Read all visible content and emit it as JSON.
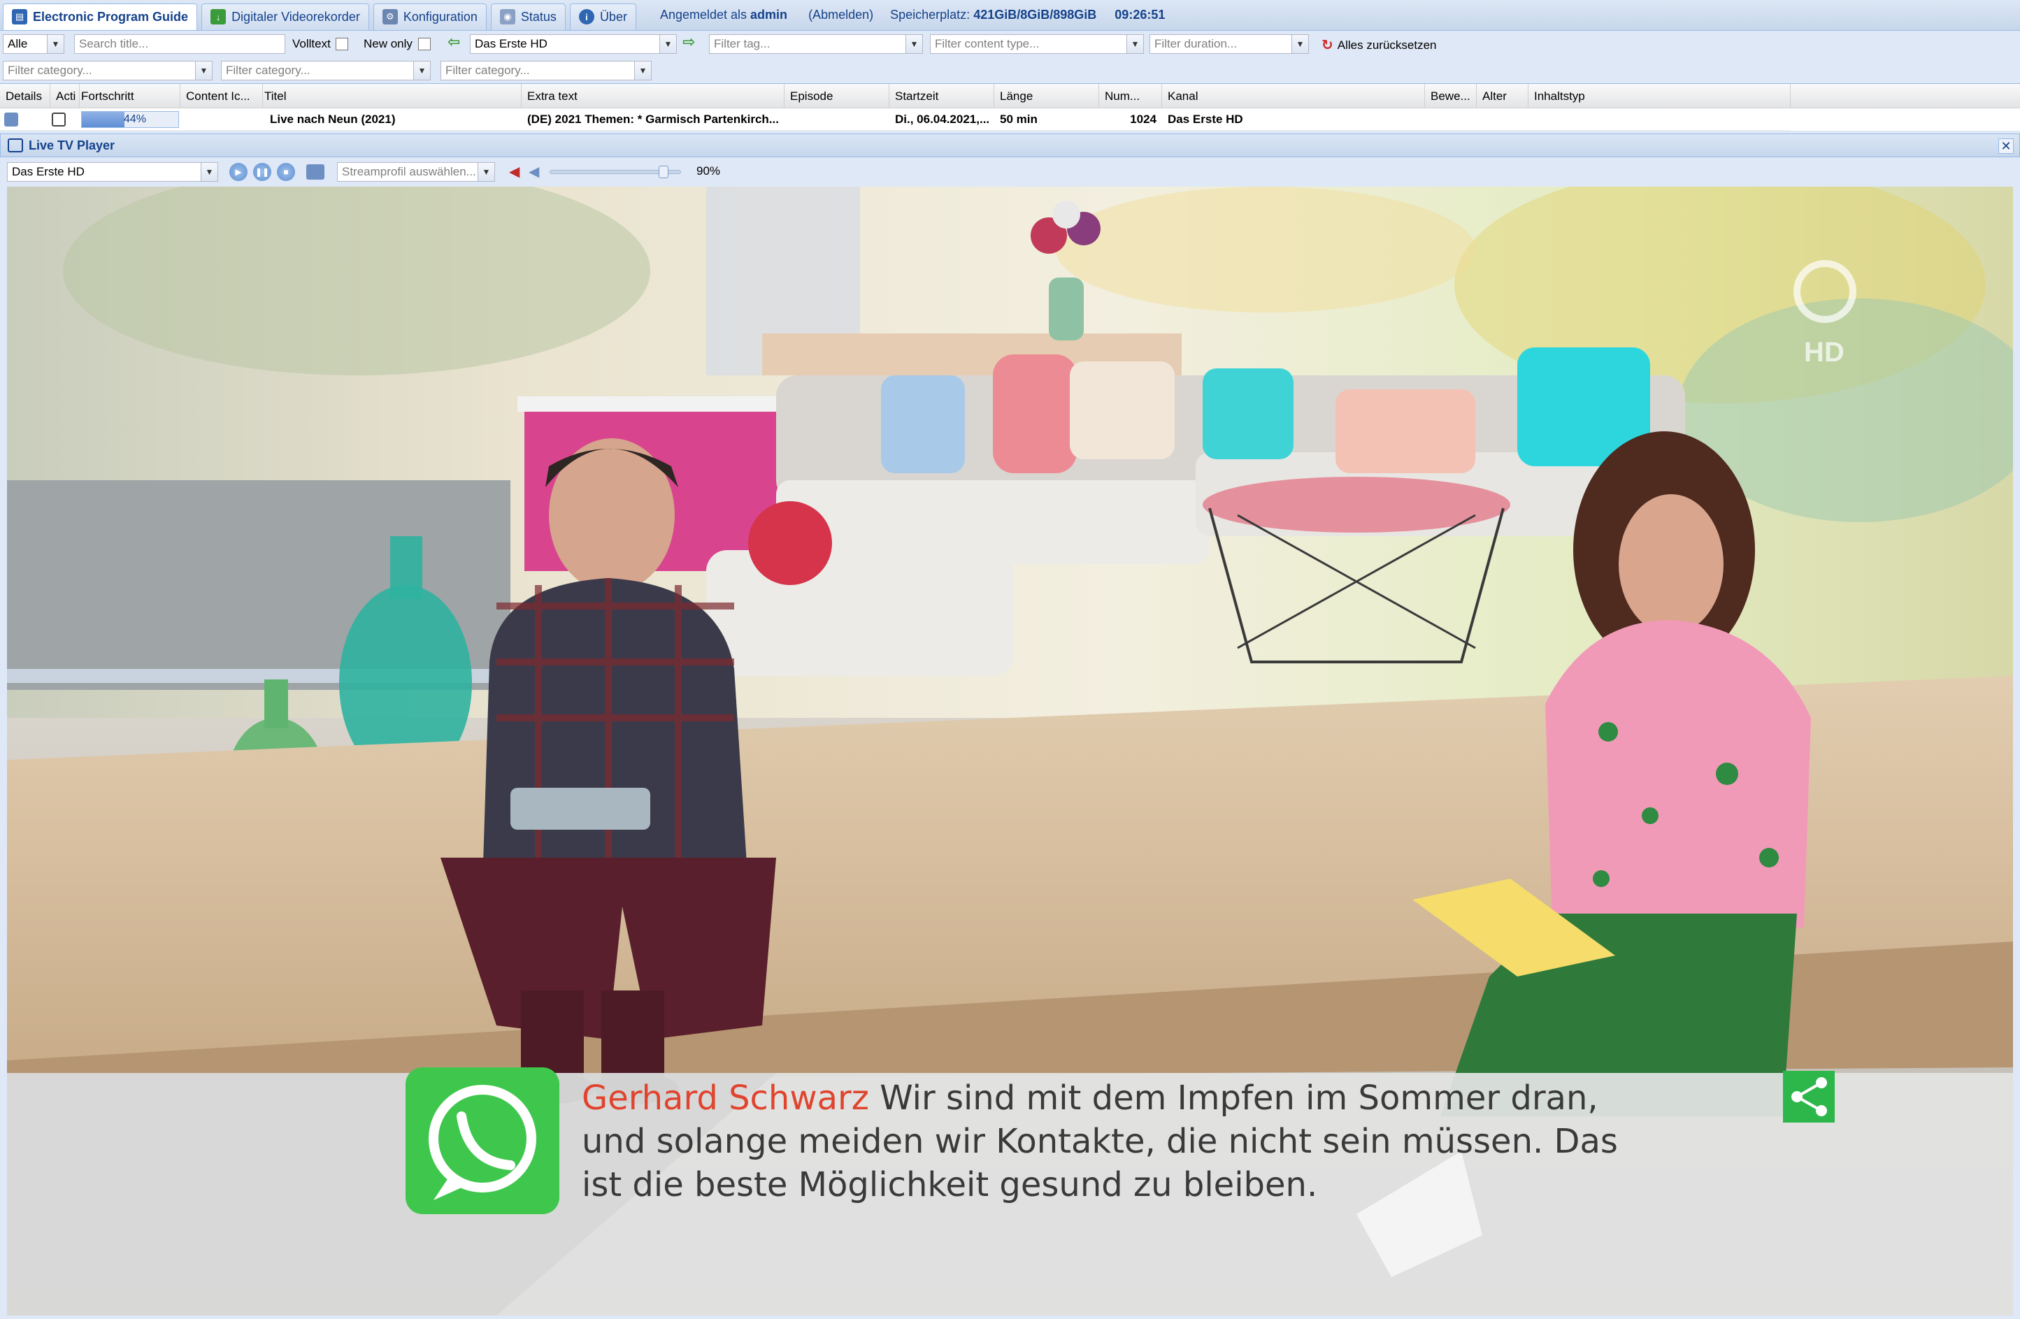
{
  "tabs": [
    {
      "label": "Electronic Program Guide",
      "icon": "epg-icon",
      "active": true
    },
    {
      "label": "Digitaler Videorekorder",
      "icon": "dvr-icon",
      "active": false
    },
    {
      "label": "Konfiguration",
      "icon": "wrench-icon",
      "active": false
    },
    {
      "label": "Status",
      "icon": "status-icon",
      "active": false
    },
    {
      "label": "Über",
      "icon": "info-icon",
      "active": false
    }
  ],
  "header": {
    "login_prefix": "Angemeldet als",
    "user": "admin",
    "logout": "(Abmelden)",
    "storage_label": "Speicherplatz:",
    "storage_value": "421GiB/8GiB/898GiB",
    "clock": "09:26:51"
  },
  "filters": {
    "all": "Alle",
    "search_placeholder": "Search title...",
    "fulltext_label": "Volltext",
    "new_only_label": "New only",
    "channel": "Das Erste HD",
    "tag_placeholder": "Filter tag...",
    "content_type_placeholder": "Filter content type...",
    "duration_placeholder": "Filter duration...",
    "reset_label": "Alles zurücksetzen",
    "category_placeholder_1": "Filter category...",
    "category_placeholder_2": "Filter category...",
    "category_placeholder_3": "Filter category..."
  },
  "grid": {
    "columns": {
      "details": "Details",
      "actions": "Acti",
      "progress": "Fortschritt",
      "content_icons": "Content Ic...",
      "title": "Titel",
      "extra_text": "Extra text",
      "episode": "Episode",
      "start": "Startzeit",
      "duration": "Länge",
      "number": "Num...",
      "channel": "Kanal",
      "rating": "Bewe...",
      "age": "Alter",
      "content_type": "Inhaltstyp"
    },
    "rows": [
      {
        "progress": 0.44,
        "progress_text": "44%",
        "title": "Live nach Neun (2021)",
        "extra_text": "(DE) 2021 Themen: * Garmisch Partenkirch...",
        "episode": "",
        "start": "Di., 06.04.2021,...",
        "duration": "50 min",
        "number": "1024",
        "channel": "Das Erste HD",
        "rating": "",
        "age": "",
        "content_type": ""
      }
    ]
  },
  "player": {
    "title": "Live TV Player",
    "channel": "Das Erste HD",
    "stream_profile_placeholder": "Streamprofil auswählen...",
    "volume": 0.9,
    "volume_text": "90%"
  },
  "broadcast": {
    "subtitle_speaker": "Gerhard Schwarz",
    "subtitle_text": "Wir sind mit dem Impfen im Sommer dran, und solange meiden wir Kontakte, die nicht sein müssen. Das ist die beste Möglichkeit gesund zu bleiben.",
    "logo_text": "HD"
  },
  "colors": {
    "accent": "#15428b",
    "panel": "#dfe8f6",
    "border": "#99bbe8",
    "whatsapp": "#3fc74d",
    "speaker": "#e0442e"
  }
}
